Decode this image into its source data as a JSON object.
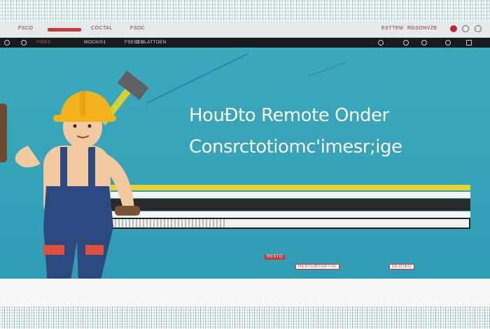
{
  "browser": {
    "tab_text_1": "FSCO",
    "tab_text_2": "COCTAL",
    "tab_text_3": "FSOC",
    "url_text": "ESTTEM",
    "right_text": "RDSONVZE"
  },
  "toolbar": {
    "item_1": "FIRES",
    "item_2": "MOCKIS1",
    "item_3": "FSECEH",
    "item_4": "D CLATTOEN"
  },
  "headline": {
    "line1": "HouÐto  Remote Onder",
    "line2": "Consrctotiomc'imesr;ige"
  },
  "labels": {
    "small_red": "RESTO",
    "label_a": "RESTEMSOPTOL",
    "label_b": "DEOTEC"
  },
  "colors": {
    "banner": "#34a2b8",
    "accent_yellow": "#e6d12f",
    "accent_red": "#c9393a",
    "helmet": "#f2b21c",
    "overalls": "#2c4a80"
  },
  "icons": [
    "search-icon",
    "refresh-icon",
    "close-icon",
    "menu-icon",
    "hammer-icon"
  ]
}
